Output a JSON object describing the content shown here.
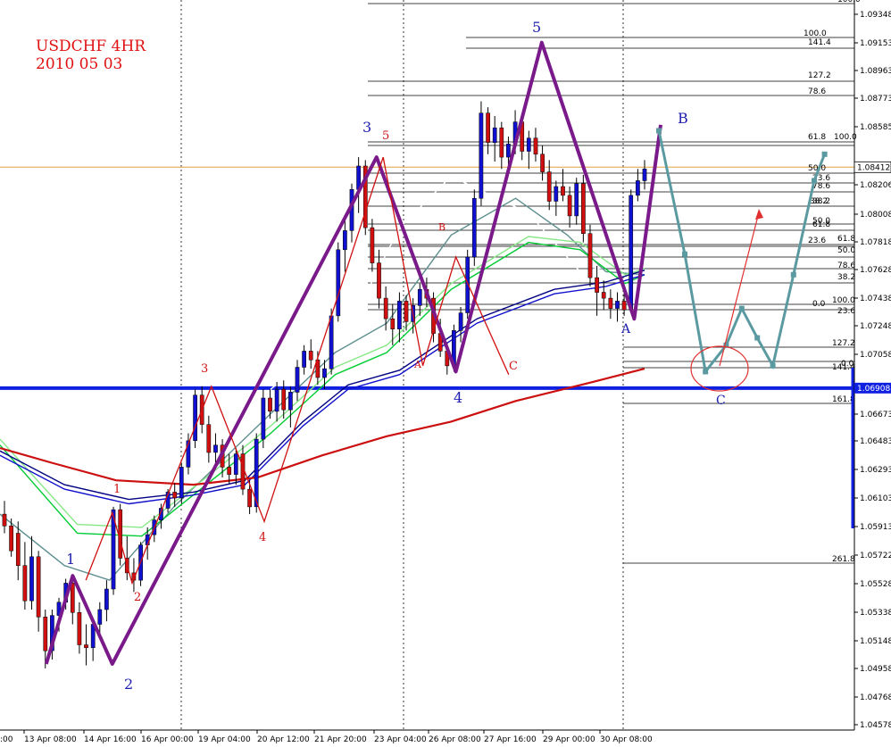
{
  "chart_data": {
    "type": "candlestick",
    "title": "USDCHF 4HR",
    "subtitle": "2010 05 03",
    "ylim": [
      1.0458,
      1.0955
    ],
    "price_ticks": [
      "1.09348",
      "1.09153",
      "1.08963",
      "1.08773",
      "1.08585",
      "1.08412",
      "1.08206",
      "1.08008",
      "1.07818",
      "1.07628",
      "1.07438",
      "1.07248",
      "1.07058",
      "1.06908",
      "1.06673",
      "1.06483",
      "1.06293",
      "1.06103",
      "1.05913",
      "1.05722",
      "1.05528",
      "1.05338",
      "1.05148",
      "1.04958",
      "1.04768",
      "1.04578"
    ],
    "current_price": "1.08412",
    "current_price_value": 1.08412,
    "support_price": "1.06908",
    "support_price_value": 1.06908,
    "time_labels": [
      "13 Apr 08:00",
      "14 Apr 16:00",
      "16 Apr 00:00",
      "19 Apr 04:00",
      "20 Apr 12:00",
      "21 Apr 20:00",
      "23 Apr 04:00",
      "26 Apr 08:00",
      "27 Apr 16:00",
      "29 Apr 00:00",
      "30 Apr 08:00"
    ],
    "time_label_partial": ":00",
    "candles": [
      [
        1.0605,
        1.0614,
        1.0592,
        1.0597
      ],
      [
        1.0597,
        1.0602,
        1.0576,
        1.058
      ],
      [
        1.0592,
        1.06,
        1.056,
        1.057
      ],
      [
        1.057,
        1.0586,
        1.054,
        1.0546
      ],
      [
        1.0546,
        1.059,
        1.054,
        1.0576
      ],
      [
        1.0576,
        1.058,
        1.0525,
        1.0535
      ],
      [
        1.0535,
        1.054,
        1.05,
        1.0512
      ],
      [
        1.0512,
        1.054,
        1.0506,
        1.0536
      ],
      [
        1.0536,
        1.0548,
        1.0525,
        1.0545
      ],
      [
        1.0545,
        1.0561,
        1.054,
        1.0558
      ],
      [
        1.0558,
        1.056,
        1.053,
        1.0538
      ],
      [
        1.0538,
        1.0545,
        1.051,
        1.0516
      ],
      [
        1.0516,
        1.053,
        1.0502,
        1.0514
      ],
      [
        1.0514,
        1.0533,
        1.0505,
        1.053
      ],
      [
        1.053,
        1.0545,
        1.052,
        1.054
      ],
      [
        1.054,
        1.056,
        1.0532,
        1.0554
      ],
      [
        1.0554,
        1.061,
        1.055,
        1.0608
      ],
      [
        1.0608,
        1.0612,
        1.057,
        1.0575
      ],
      [
        1.0575,
        1.059,
        1.056,
        1.0565
      ],
      [
        1.0565,
        1.0575,
        1.0552,
        1.056
      ],
      [
        1.056,
        1.0586,
        1.0556,
        1.0584
      ],
      [
        1.0584,
        1.0596,
        1.0574,
        1.0591
      ],
      [
        1.0591,
        1.0604,
        1.0586,
        1.0601
      ],
      [
        1.0601,
        1.0612,
        1.0595,
        1.0609
      ],
      [
        1.0609,
        1.0622,
        1.0606,
        1.062
      ],
      [
        1.062,
        1.0626,
        1.061,
        1.0616
      ],
      [
        1.0616,
        1.064,
        1.0612,
        1.0637
      ],
      [
        1.0637,
        1.066,
        1.0632,
        1.0655
      ],
      [
        1.0655,
        1.069,
        1.065,
        1.0686
      ],
      [
        1.0686,
        1.0692,
        1.066,
        1.0666
      ],
      [
        1.0666,
        1.0672,
        1.064,
        1.0647
      ],
      [
        1.0647,
        1.066,
        1.0636,
        1.0652
      ],
      [
        1.0652,
        1.0656,
        1.063,
        1.0637
      ],
      [
        1.0637,
        1.0646,
        1.0626,
        1.0632
      ],
      [
        1.0632,
        1.065,
        1.0625,
        1.0646
      ],
      [
        1.0646,
        1.0652,
        1.0618,
        1.0622
      ],
      [
        1.0622,
        1.0628,
        1.0605,
        1.061
      ],
      [
        1.061,
        1.066,
        1.0606,
        1.0656
      ],
      [
        1.0656,
        1.069,
        1.065,
        1.0684
      ],
      [
        1.0684,
        1.069,
        1.067,
        1.0675
      ],
      [
        1.0675,
        1.0695,
        1.0668,
        1.069
      ],
      [
        1.069,
        1.0696,
        1.067,
        1.0676
      ],
      [
        1.0676,
        1.0692,
        1.0664,
        1.0688
      ],
      [
        1.0688,
        1.071,
        1.0682,
        1.0705
      ],
      [
        1.0705,
        1.072,
        1.07,
        1.0716
      ],
      [
        1.0716,
        1.0724,
        1.0704,
        1.071
      ],
      [
        1.071,
        1.0716,
        1.0693,
        1.0698
      ],
      [
        1.0698,
        1.071,
        1.069,
        1.0704
      ],
      [
        1.0704,
        1.0745,
        1.07,
        1.074
      ],
      [
        1.074,
        1.079,
        1.0736,
        1.0785
      ],
      [
        1.0785,
        1.0806,
        1.077,
        1.0798
      ],
      [
        1.0798,
        1.083,
        1.079,
        1.0826
      ],
      [
        1.0826,
        1.0848,
        1.081,
        1.0842
      ],
      [
        1.0842,
        1.0846,
        1.0795,
        1.08
      ],
      [
        1.08,
        1.0806,
        1.077,
        1.0776
      ],
      [
        1.0776,
        1.0785,
        1.0745,
        1.0752
      ],
      [
        1.0752,
        1.076,
        1.073,
        1.0738
      ],
      [
        1.0738,
        1.0748,
        1.072,
        1.0731
      ],
      [
        1.0731,
        1.0756,
        1.0722,
        1.075
      ],
      [
        1.075,
        1.0754,
        1.073,
        1.0736
      ],
      [
        1.0736,
        1.0752,
        1.0728,
        1.0747
      ],
      [
        1.0747,
        1.0762,
        1.074,
        1.0758
      ],
      [
        1.0758,
        1.0766,
        1.0746,
        1.0752
      ],
      [
        1.0752,
        1.0756,
        1.0722,
        1.0728
      ],
      [
        1.0728,
        1.0738,
        1.0712,
        1.0716
      ],
      [
        1.0716,
        1.0722,
        1.07,
        1.0706
      ],
      [
        1.0706,
        1.0734,
        1.0702,
        1.073
      ],
      [
        1.073,
        1.0746,
        1.0722,
        1.0742
      ],
      [
        1.0742,
        1.0785,
        1.0738,
        1.078
      ],
      [
        1.078,
        1.0826,
        1.0774,
        1.082
      ],
      [
        1.082,
        1.0886,
        1.0815,
        1.0878
      ],
      [
        1.0878,
        1.0882,
        1.085,
        1.0858
      ],
      [
        1.0858,
        1.0876,
        1.0845,
        1.0868
      ],
      [
        1.0868,
        1.0872,
        1.084,
        1.0848
      ],
      [
        1.0848,
        1.0862,
        1.0836,
        1.0857
      ],
      [
        1.0857,
        1.088,
        1.085,
        1.0872
      ],
      [
        1.0872,
        1.0876,
        1.0846,
        1.0852
      ],
      [
        1.0852,
        1.0866,
        1.084,
        1.0861
      ],
      [
        1.0861,
        1.0868,
        1.0845,
        1.085
      ],
      [
        1.085,
        1.0856,
        1.0832,
        1.0838
      ],
      [
        1.0838,
        1.0846,
        1.0812,
        1.0818
      ],
      [
        1.0818,
        1.0832,
        1.0808,
        1.0828
      ],
      [
        1.0828,
        1.084,
        1.0818,
        1.0822
      ],
      [
        1.0822,
        1.0828,
        1.08,
        1.0808
      ],
      [
        1.0808,
        1.0834,
        1.0802,
        1.083
      ],
      [
        1.083,
        1.0836,
        1.079,
        1.0796
      ],
      [
        1.0796,
        1.0802,
        1.076,
        1.0766
      ],
      [
        1.0766,
        1.0774,
        1.074,
        1.0756
      ],
      [
        1.0756,
        1.0764,
        1.0744,
        1.0752
      ],
      [
        1.0752,
        1.0758,
        1.0738,
        1.0745
      ],
      [
        1.0745,
        1.0756,
        1.0736,
        1.075
      ],
      [
        1.075,
        1.0758,
        1.074,
        1.0744
      ],
      [
        1.0744,
        1.0826,
        1.0742,
        1.0822
      ],
      [
        1.0822,
        1.084,
        1.0818,
        1.0832
      ],
      [
        1.0832,
        1.0846,
        1.0826,
        1.084
      ]
    ],
    "moving_averages": [
      {
        "color": "#ffffff",
        "points": [
          [
            1.064,
            0
          ],
          [
            1.0585,
            0.12
          ],
          [
            1.058,
            0.22
          ],
          [
            1.0625,
            0.33
          ],
          [
            1.069,
            0.42
          ],
          [
            1.072,
            0.5
          ],
          [
            1.074,
            0.55
          ],
          [
            1.08,
            0.62
          ],
          [
            1.0835,
            0.7
          ],
          [
            1.081,
            0.82
          ],
          [
            1.077,
            0.9
          ],
          [
            1.0778,
            1
          ]
        ]
      },
      {
        "color": "#5f8f8f",
        "points": [
          [
            1.0605,
            0
          ],
          [
            1.057,
            0.1
          ],
          [
            1.056,
            0.17
          ],
          [
            1.061,
            0.27
          ],
          [
            1.0665,
            0.4
          ],
          [
            1.0715,
            0.52
          ],
          [
            1.0735,
            0.6
          ],
          [
            1.0795,
            0.7
          ],
          [
            1.082,
            0.8
          ],
          [
            1.0795,
            0.88
          ],
          [
            1.077,
            0.94
          ],
          [
            1.0768,
            1
          ]
        ]
      },
      {
        "color": "#00cc33",
        "points": [
          [
            1.0652,
            0
          ],
          [
            1.0592,
            0.12
          ],
          [
            1.059,
            0.22
          ],
          [
            1.0625,
            0.32
          ],
          [
            1.066,
            0.42
          ],
          [
            1.07,
            0.52
          ],
          [
            1.0715,
            0.6
          ],
          [
            1.0758,
            0.7
          ],
          [
            1.079,
            0.82
          ],
          [
            1.0785,
            0.9
          ],
          [
            1.0762,
            0.97
          ],
          [
            1.0768,
            1
          ]
        ]
      },
      {
        "color": "#88e888",
        "points": [
          [
            1.0656,
            0
          ],
          [
            1.0598,
            0.12
          ],
          [
            1.0596,
            0.22
          ],
          [
            1.063,
            0.32
          ],
          [
            1.0665,
            0.42
          ],
          [
            1.0705,
            0.52
          ],
          [
            1.072,
            0.6
          ],
          [
            1.0762,
            0.7
          ],
          [
            1.0794,
            0.82
          ],
          [
            1.079,
            0.9
          ],
          [
            1.0768,
            0.97
          ],
          [
            1.0772,
            1
          ]
        ]
      },
      {
        "color": "#1010cc",
        "points": [
          [
            1.0645,
            0
          ],
          [
            1.0622,
            0.1
          ],
          [
            1.0612,
            0.2
          ],
          [
            1.0618,
            0.3
          ],
          [
            1.0625,
            0.38
          ],
          [
            1.0665,
            0.47
          ],
          [
            1.069,
            0.54
          ],
          [
            1.07,
            0.62
          ],
          [
            1.0735,
            0.74
          ],
          [
            1.0755,
            0.86
          ],
          [
            1.076,
            0.94
          ],
          [
            1.0768,
            1
          ]
        ]
      },
      {
        "color": "#000080",
        "points": [
          [
            1.0648,
            0
          ],
          [
            1.0625,
            0.1
          ],
          [
            1.0615,
            0.2
          ],
          [
            1.062,
            0.3
          ],
          [
            1.0628,
            0.38
          ],
          [
            1.0668,
            0.47
          ],
          [
            1.0693,
            0.54
          ],
          [
            1.0703,
            0.62
          ],
          [
            1.0738,
            0.74
          ],
          [
            1.0758,
            0.86
          ],
          [
            1.0763,
            0.94
          ],
          [
            1.0771,
            1
          ]
        ]
      },
      {
        "color": "#cc1010",
        "points": [
          [
            1.065,
            0
          ],
          [
            1.064,
            0.08
          ],
          [
            1.0628,
            0.18
          ],
          [
            1.0625,
            0.3
          ],
          [
            1.063,
            0.4
          ],
          [
            1.0645,
            0.5
          ],
          [
            1.0658,
            0.6
          ],
          [
            1.0668,
            0.7
          ],
          [
            1.0682,
            0.8
          ],
          [
            1.0695,
            0.92
          ],
          [
            1.0704,
            1
          ]
        ]
      }
    ],
    "waves": {
      "purple": [
        [
          1.0503,
          0.07
        ],
        [
          1.0563,
          0.11
        ],
        [
          1.0503,
          0.17
        ],
        [
          1.0848,
          0.57
        ],
        [
          1.0702,
          0.69
        ],
        [
          1.0926,
          0.82
        ],
        [
          1.0738,
          0.96
        ],
        [
          1.087,
          1.0
        ]
      ],
      "red_small": [
        [
          1.056,
          0.13
        ],
        [
          1.0606,
          0.17
        ],
        [
          1.0558,
          0.2
        ],
        [
          1.0692,
          0.32
        ],
        [
          1.06,
          0.4
        ],
        [
          1.0848,
          0.58
        ],
        [
          1.0706,
          0.64
        ],
        [
          1.078,
          0.69
        ],
        [
          1.07,
          0.77
        ]
      ],
      "teal_projection": [
        [
          1.0866,
          0.0
        ],
        [
          1.0782,
          0.05
        ],
        [
          1.0702,
          0.09
        ],
        [
          1.072,
          0.13
        ],
        [
          1.0745,
          0.16
        ],
        [
          1.0725,
          0.19
        ],
        [
          1.0706,
          0.22
        ],
        [
          1.0768,
          0.26
        ],
        [
          1.0832,
          0.3
        ],
        [
          1.085,
          0.32
        ]
      ]
    },
    "wave_labels": [
      {
        "text": "1",
        "color": "#2020b0"
      },
      {
        "text": "2",
        "color": "#2020b0"
      },
      {
        "text": "3",
        "color": "#2020b0"
      },
      {
        "text": "4",
        "color": "#2020b0"
      },
      {
        "text": "5",
        "color": "#2020b0"
      },
      {
        "text": "A",
        "color": "#2020b0"
      },
      {
        "text": "B",
        "color": "#2020b0"
      },
      {
        "text": "C",
        "color": "#2020b0"
      },
      {
        "text": "1",
        "color": "#d01010"
      },
      {
        "text": "2",
        "color": "#d01010"
      },
      {
        "text": "3",
        "color": "#d01010"
      },
      {
        "text": "4",
        "color": "#d01010"
      },
      {
        "text": "5",
        "color": "#d01010"
      },
      {
        "text": "A",
        "color": "#d01010"
      },
      {
        "text": "B",
        "color": "#d01010"
      },
      {
        "text": "C",
        "color": "#d01010"
      }
    ],
    "fib_labels_upper": [
      "100.0",
      "141.4",
      "127.2",
      "78.6",
      "61.8",
      "100.0",
      "50.0",
      "23.6",
      "78.6",
      "38.2",
      "38.2",
      "50.0",
      "61.8",
      "23.6",
      "61.8",
      "50.0",
      "78.6",
      "38.2",
      "100.0",
      "0.0",
      "23.6"
    ],
    "fib_labels_lower": [
      "127.2",
      "0.0",
      "141.4",
      "161.8",
      "261.8"
    ],
    "fib_top_partial": "100.0"
  }
}
